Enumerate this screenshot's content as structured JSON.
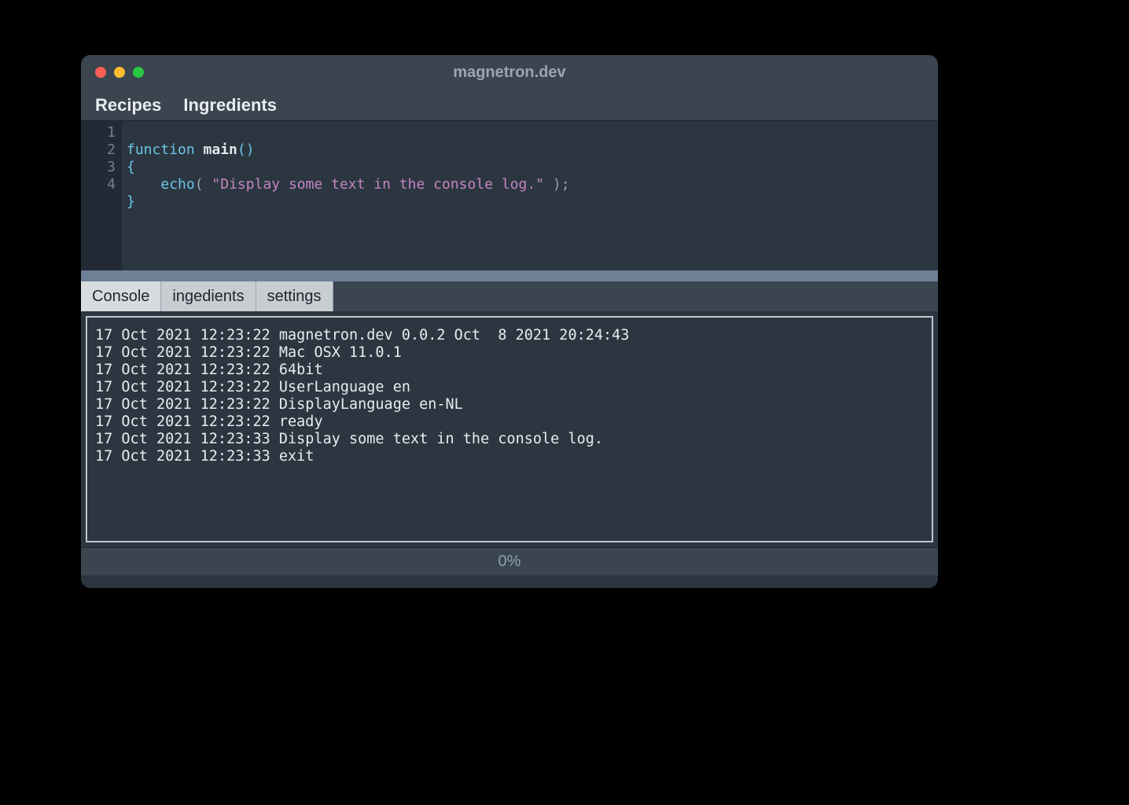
{
  "window": {
    "title": "magnetron.dev"
  },
  "menubar": {
    "items": [
      "Recipes",
      "Ingredients"
    ]
  },
  "editor": {
    "lines": [
      {
        "n": "1",
        "kw": "function",
        "fn": "main",
        "paren": "()"
      },
      {
        "n": "2",
        "brace": "{"
      },
      {
        "n": "3",
        "indent": "    ",
        "call": "echo",
        "open": "( ",
        "str": "\"Display some text in the console log.\"",
        "close": " );"
      },
      {
        "n": "4",
        "brace": "}"
      }
    ]
  },
  "tabs": {
    "items": [
      "Console",
      "ingedients",
      "settings"
    ],
    "active_index": 0
  },
  "console": {
    "lines": [
      "17 Oct 2021 12:23:22 magnetron.dev 0.0.2 Oct  8 2021 20:24:43",
      "17 Oct 2021 12:23:22 Mac OSX 11.0.1",
      "17 Oct 2021 12:23:22 64bit",
      "17 Oct 2021 12:23:22 UserLanguage en",
      "17 Oct 2021 12:23:22 DisplayLanguage en-NL",
      "17 Oct 2021 12:23:22 ready",
      "17 Oct 2021 12:23:33 Display some text in the console log.",
      "17 Oct 2021 12:23:33 exit"
    ]
  },
  "status": {
    "text": "0%"
  }
}
